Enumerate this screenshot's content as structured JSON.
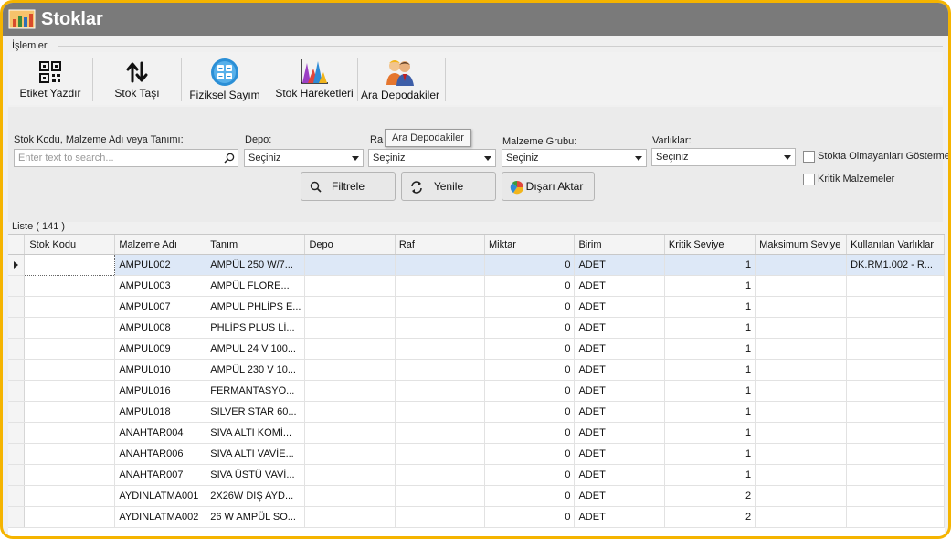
{
  "window": {
    "title": "Stoklar"
  },
  "ribbon": {
    "group_caption": "İşlemler",
    "buttons": [
      {
        "label": "Etiket Yazdır",
        "icon": "qr-code-icon"
      },
      {
        "label": "Stok Taşı",
        "icon": "transfer-arrows-icon"
      },
      {
        "label": "Fiziksel Sayım",
        "icon": "count-grid-icon"
      },
      {
        "label": "Stok Hareketleri",
        "icon": "area-chart-icon"
      },
      {
        "label": "Ara Depodakiler",
        "icon": "people-icon"
      }
    ]
  },
  "filters": {
    "search_label": "Stok Kodu, Malzeme Adı veya Tanımı:",
    "search_placeholder": "Enter text to search...",
    "depo_label": "Depo:",
    "depo_value": "Seçiniz",
    "raf_label": "Ra",
    "raf_value": "Seçiniz",
    "group_label": "Malzeme Grubu:",
    "group_value": "Seçiniz",
    "assets_label": "Varlıklar:",
    "assets_value": "Seçiniz",
    "check_out_of_stock": "Stokta Olmayanları Gösterme",
    "check_critical": "Kritik Malzemeler",
    "filter_button": "Filtrele",
    "refresh_button": "Yenile",
    "export_button": "Dışarı Aktar"
  },
  "tooltip": "Ara Depodakiler",
  "list": {
    "caption": "Liste ( 141 )",
    "columns": [
      "Stok Kodu",
      "Malzeme Adı",
      "Tanım",
      "Depo",
      "Raf",
      "Miktar",
      "Birim",
      "Kritik Seviye",
      "Maksimum Seviye",
      "Kullanılan Varlıklar"
    ],
    "rows": [
      [
        "",
        "AMPUL002",
        "AMPÜL 250 W/7...",
        "",
        "",
        "0",
        "ADET",
        "1",
        "",
        "DK.RM1.002 - R..."
      ],
      [
        "",
        "AMPUL003",
        "AMPÜL    FLORE...",
        "",
        "",
        "0",
        "ADET",
        "1",
        "",
        ""
      ],
      [
        "",
        "AMPUL007",
        "AMPUL PHLİPS E...",
        "",
        "",
        "0",
        "ADET",
        "1",
        "",
        ""
      ],
      [
        "",
        "AMPUL008",
        " PHLİPS PLUS Lİ...",
        "",
        "",
        "0",
        "ADET",
        "1",
        "",
        ""
      ],
      [
        "",
        "AMPUL009",
        "AMPUL 24 V 100...",
        "",
        "",
        "0",
        "ADET",
        "1",
        "",
        ""
      ],
      [
        "",
        "AMPUL010",
        "AMPÜL 230 V 10...",
        "",
        "",
        "0",
        "ADET",
        "1",
        "",
        ""
      ],
      [
        "",
        "AMPUL016",
        "FERMANTASYO...",
        "",
        "",
        "0",
        "ADET",
        "1",
        "",
        ""
      ],
      [
        "",
        "AMPUL018",
        "SILVER STAR 60...",
        "",
        "",
        "0",
        "ADET",
        "1",
        "",
        ""
      ],
      [
        "",
        "ANAHTAR004",
        "SIVA ALTI KOMİ...",
        "",
        "",
        "0",
        "ADET",
        "1",
        "",
        ""
      ],
      [
        "",
        "ANAHTAR006",
        "SIVA ALTI VAVİE...",
        "",
        "",
        "0",
        "ADET",
        "1",
        "",
        ""
      ],
      [
        "",
        "ANAHTAR007",
        "SIVA ÜSTÜ VAVİ...",
        "",
        "",
        "0",
        "ADET",
        "1",
        "",
        ""
      ],
      [
        "",
        "AYDINLATMA001",
        "2X26W DIŞ AYD...",
        "",
        "",
        "0",
        "ADET",
        "2",
        "",
        ""
      ],
      [
        "",
        "AYDINLATMA002",
        "26 W AMPÜL SO...",
        "",
        "",
        "0",
        "ADET",
        "2",
        "",
        ""
      ]
    ]
  }
}
